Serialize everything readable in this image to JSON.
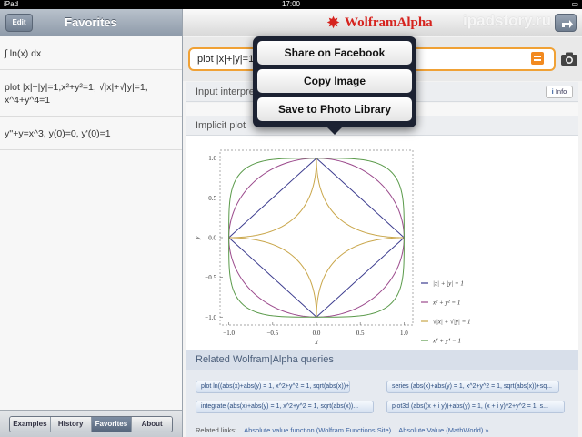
{
  "status_bar": {
    "carrier": "iPad",
    "time": "17:00"
  },
  "sidebar": {
    "edit_label": "Edit",
    "title": "Favorites",
    "favorites": [
      "∫ ln(x) dx",
      "plot |x|+|y|=1,x²+y²=1, √|x|+√|y|=1, x^4+y^4=1",
      "y''+y=x^3, y(0)=0, y'(0)=1"
    ],
    "tabs": [
      "Examples",
      "History",
      "Favorites",
      "About"
    ],
    "active_tab": "Favorites"
  },
  "header": {
    "logo_text": "WolframAlpha",
    "watermark": "ipadstory.ru",
    "share_icon": "share-arrow-icon"
  },
  "input": {
    "value": "plot |x|+|y|=1"
  },
  "pods": {
    "interpretation": {
      "title": "Input interpretation",
      "info_label": "Info"
    },
    "plot": {
      "title": "Implicit plot"
    }
  },
  "popover": {
    "items": [
      "Share on Facebook",
      "Copy Image",
      "Save to Photo Library"
    ]
  },
  "related": {
    "title": "Related Wolfram|Alpha queries",
    "queries": [
      "plot ln((abs(x)+abs(y) = 1, x^2+y^2 = 1, sqrt(abs(x))+s...",
      "series (abs(x)+abs(y) = 1, x^2+y^2 = 1, sqrt(abs(x))+sq...",
      "integrate (abs(x)+abs(y) = 1, x^2+y^2 = 1, sqrt(abs(x))...",
      "plot3d (abs((x + i y))+abs(y) = 1, (x + i y)^2+y^2 = 1, s..."
    ],
    "links_label": "Related links:",
    "links": [
      "Absolute value function (Wolfram Functions Site)",
      "Absolute Value (MathWorld) »"
    ]
  },
  "chart_data": {
    "type": "line",
    "xlabel": "x",
    "ylabel": "y",
    "xlim": [
      -1.0,
      1.0
    ],
    "ylim": [
      -1.0,
      1.0
    ],
    "x_ticks": [
      "−1.0",
      "−0.5",
      "0.0",
      "0.5",
      "1.0"
    ],
    "y_ticks": [
      "1.0",
      "0.5",
      "0.0",
      "−0.5",
      "−1.0"
    ],
    "legend_position": "bottom-right",
    "series": [
      {
        "name": "|x| + |y| = 1",
        "color": "#3d3d8f",
        "curve": "diamond"
      },
      {
        "name": "x² + y² = 1",
        "color": "#9b4a8c",
        "curve": "circle"
      },
      {
        "name": "√|x| + √|y| = 1",
        "color": "#c9a64a",
        "curve": "astroid"
      },
      {
        "name": "x⁴ + y⁴ = 1",
        "color": "#5a9a4a",
        "curve": "superellipse"
      }
    ]
  }
}
